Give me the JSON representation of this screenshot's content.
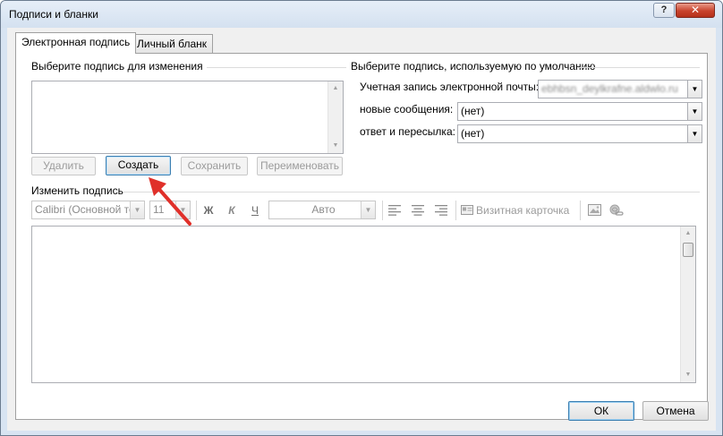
{
  "window": {
    "title": "Подписи и бланки",
    "help_label": "?",
    "close_label": "✕"
  },
  "tabs": [
    {
      "label": "Электронная подпись",
      "active": true
    },
    {
      "label": "Личный бланк",
      "active": false
    }
  ],
  "select_signature": {
    "label": "Выберите подпись для изменения",
    "items": []
  },
  "actions": {
    "delete_label": "Удалить",
    "new_label": "Создать",
    "save_label": "Сохранить",
    "rename_label": "Переименовать"
  },
  "defaults": {
    "label": "Выберите подпись, используемую по умолчанию",
    "account_label": "Учетная запись электронной почты:",
    "account_value": "ebhbsn_deylkrafne.aldwlo.ru",
    "new_messages_label": "новые сообщения:",
    "new_messages_value": "(нет)",
    "replies_label": "ответ и пересылка:",
    "replies_value": "(нет)"
  },
  "edit": {
    "label": "Изменить подпись",
    "font_value": "Calibri (Основной текс",
    "size_value": "11",
    "bold_label": "Ж",
    "italic_label": "К",
    "underline_label": "Ч",
    "color_value": "Авто",
    "business_card_label": "Визитная карточка",
    "align_icons": [
      "align-left-icon",
      "align-center-icon",
      "align-right-icon"
    ]
  },
  "footer": {
    "ok_label": "ОК",
    "cancel_label": "Отмена"
  },
  "annotation": {
    "arrow_color": "#e0302a"
  }
}
